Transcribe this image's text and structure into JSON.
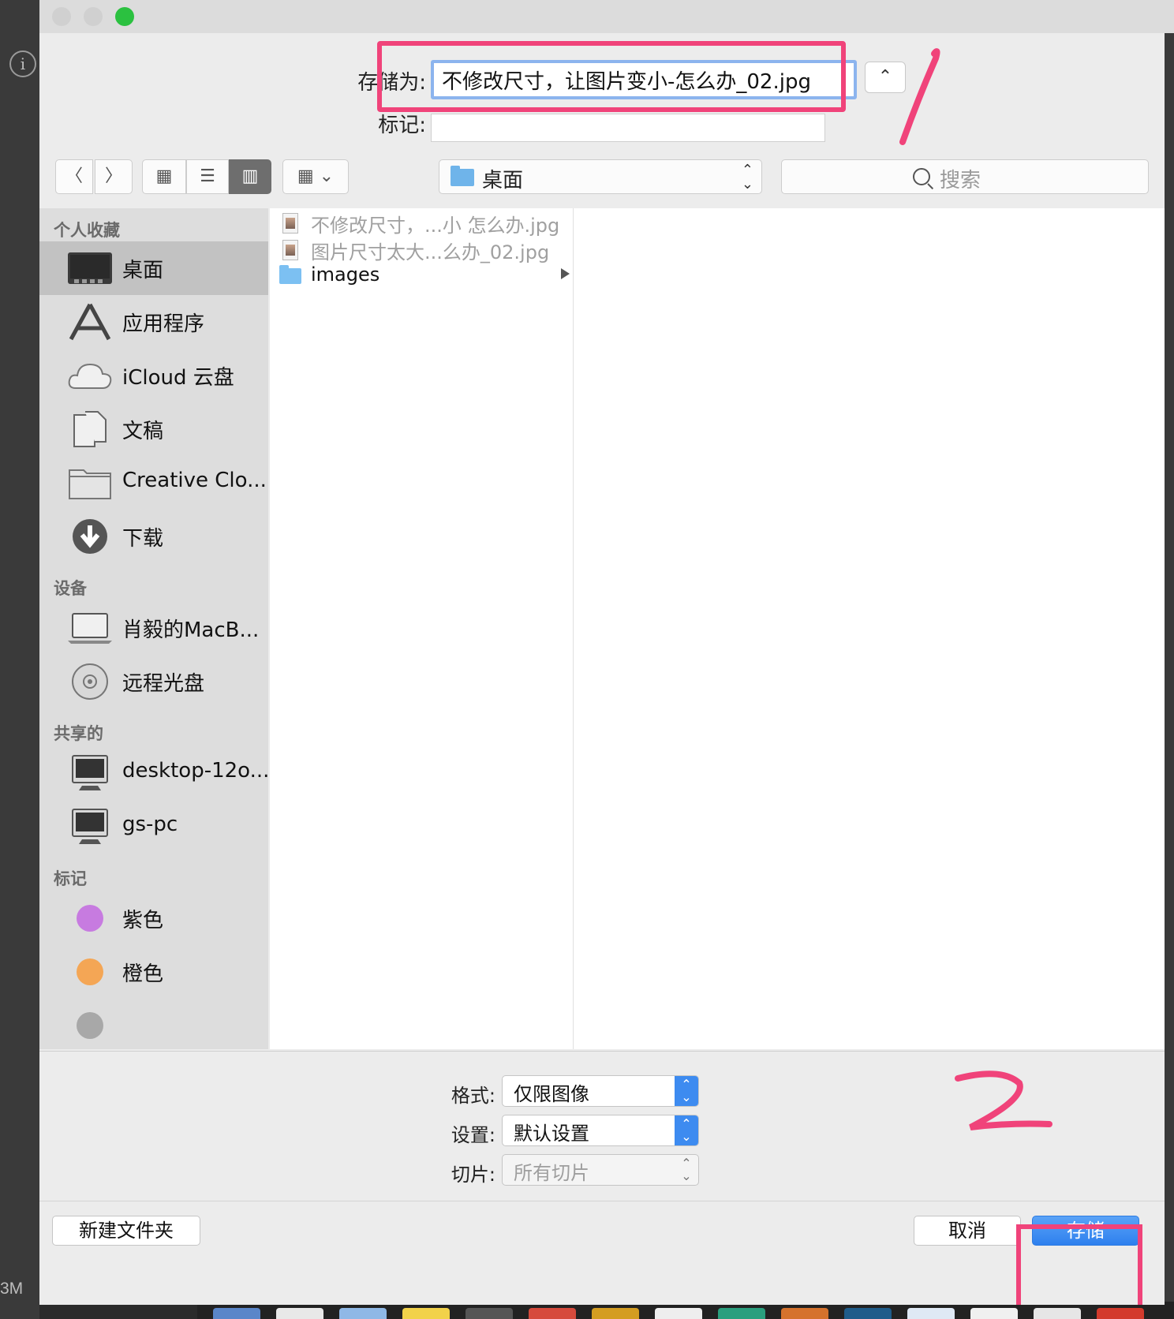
{
  "dialog": {
    "save_as_label": "存储为:",
    "filename_value": "不修改尺寸，让图片变小-怎么办_02.jpg",
    "tags_label": "标记:",
    "tags_value": "",
    "location": "桌面",
    "search_placeholder": "搜索"
  },
  "sidebar": {
    "sections": [
      {
        "title": "个人收藏",
        "items": [
          {
            "label": "桌面",
            "icon": "desktop-icon",
            "selected": true
          },
          {
            "label": "应用程序",
            "icon": "applications-icon"
          },
          {
            "label": "iCloud 云盘",
            "icon": "cloud-icon"
          },
          {
            "label": "文稿",
            "icon": "documents-icon"
          },
          {
            "label": "Creative Clo...",
            "icon": "folder-icon"
          },
          {
            "label": "下载",
            "icon": "download-icon"
          }
        ]
      },
      {
        "title": "设备",
        "items": [
          {
            "label": "肖毅的MacB...",
            "icon": "laptop-icon"
          },
          {
            "label": "远程光盘",
            "icon": "disc-icon"
          }
        ]
      },
      {
        "title": "共享的",
        "items": [
          {
            "label": "desktop-12o...",
            "icon": "monitor-icon"
          },
          {
            "label": "gs-pc",
            "icon": "monitor-icon"
          }
        ]
      },
      {
        "title": "标记",
        "items": [
          {
            "label": "紫色",
            "icon": "tag-dot-icon",
            "color": "#c77be0"
          },
          {
            "label": "橙色",
            "icon": "tag-dot-icon",
            "color": "#f4a655"
          }
        ]
      }
    ]
  },
  "files": [
    {
      "name": "不修改尺寸，...小 怎么办.jpg",
      "kind": "image",
      "dimmed": true
    },
    {
      "name": "图片尺寸太大...么办_02.jpg",
      "kind": "image",
      "dimmed": true
    },
    {
      "name": "images",
      "kind": "folder",
      "dimmed": false
    }
  ],
  "options": {
    "format_label": "格式:",
    "format_value": "仅限图像",
    "settings_label": "设置:",
    "settings_value": "默认设置",
    "slices_label": "切片:",
    "slices_value": "所有切片"
  },
  "buttons": {
    "new_folder": "新建文件夹",
    "cancel": "取消",
    "save": "存储"
  },
  "background": {
    "size_text": "3M"
  },
  "colors": {
    "accent": "#3d8bf0",
    "annotation": "#f0437a",
    "selection": "#c2c2c2"
  }
}
